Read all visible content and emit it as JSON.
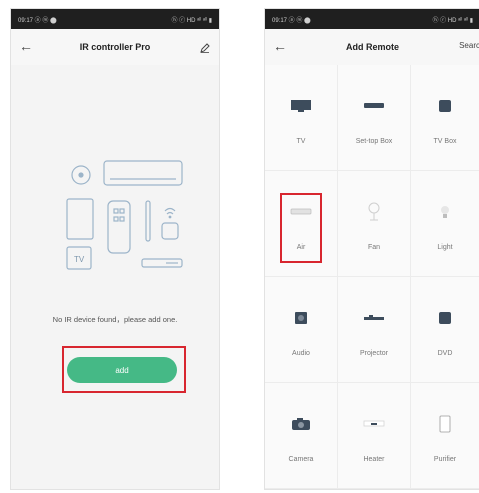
{
  "left_screen": {
    "status": {
      "left": "09:17 ⓐ ⓜ ⬤",
      "right": "ⓗ ⓡ HD ᵃˡˡ ᵃˡˡ ▮"
    },
    "title": "IR controller Pro",
    "back_icon": "arrow-left-icon",
    "edit_icon": "pencil-icon",
    "illustration": {
      "tv_label": "TV"
    },
    "message": "No IR device found，please add one.",
    "add_label": "add",
    "accent": "#45b986",
    "highlight": "#d8262f"
  },
  "right_screen": {
    "status": {
      "left": "09:17 ⓐ ⓜ ⬤",
      "right": "ⓗ ⓡ HD ᵃˡˡ ᵃˡˡ ▮"
    },
    "title": "Add Remote",
    "search_label": "Searc",
    "back_icon": "arrow-left-icon",
    "devices": [
      {
        "label": "TV",
        "icon": "tv-icon"
      },
      {
        "label": "Set-top Box",
        "icon": "set-top-box-icon"
      },
      {
        "label": "TV Box",
        "icon": "tv-box-icon"
      },
      {
        "label": "Air",
        "icon": "air-conditioner-icon"
      },
      {
        "label": "Fan",
        "icon": "fan-icon"
      },
      {
        "label": "Light",
        "icon": "light-bulb-icon"
      },
      {
        "label": "Audio",
        "icon": "audio-icon"
      },
      {
        "label": "Projector",
        "icon": "projector-icon"
      },
      {
        "label": "DVD",
        "icon": "dvd-icon"
      },
      {
        "label": "Camera",
        "icon": "camera-icon"
      },
      {
        "label": "Heater",
        "icon": "heater-icon"
      },
      {
        "label": "Purifier",
        "icon": "purifier-icon"
      }
    ],
    "selected": "Air"
  }
}
